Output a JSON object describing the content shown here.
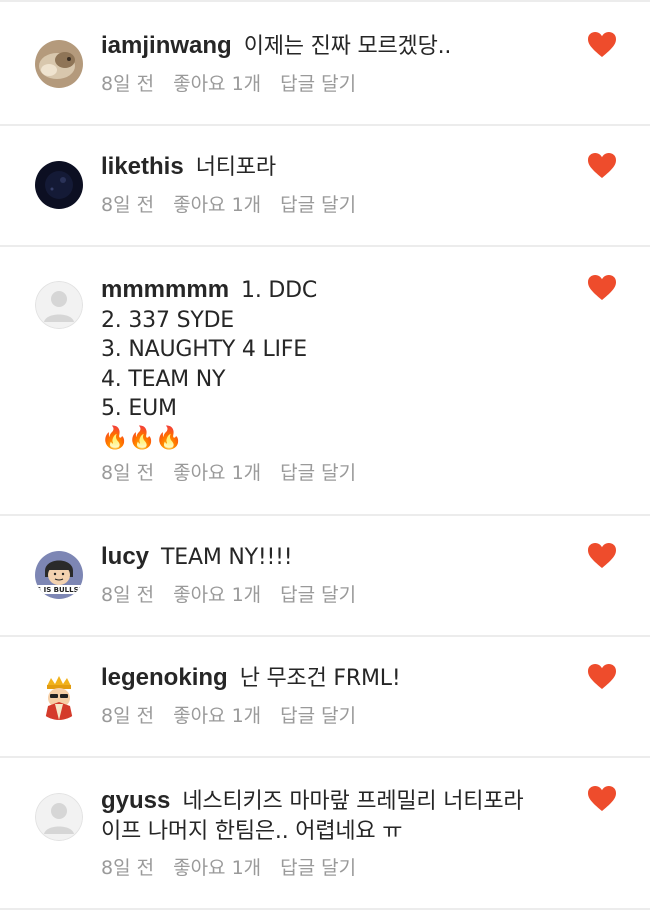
{
  "comments": [
    {
      "username": "iamjinwang",
      "text": "이제는 진짜 모르겠당..",
      "time": "8일 전",
      "likes": "좋아요 1개",
      "reply": "답글 달기",
      "avatar": "cat-photo"
    },
    {
      "username": "likethis",
      "text": "너티포라",
      "time": "8일 전",
      "likes": "좋아요 1개",
      "reply": "답글 달기",
      "avatar": "dark-photo"
    },
    {
      "username": "mmmmmm",
      "text": "1. DDC\n2. 337 SYDE\n3. NAUGHTY 4 LIFE\n4. TEAM NY\n5. EUM\n🔥🔥🔥",
      "time": "8일 전",
      "likes": "좋아요 1개",
      "reply": "답글 달기",
      "avatar": "default-person"
    },
    {
      "username": "lucy",
      "text": "TEAM NY!!!!",
      "time": "8일 전",
      "likes": "좋아요 1개",
      "reply": "답글 달기",
      "avatar": "cartoon-lucy",
      "avatar_caption": "IS IS BULLSH"
    },
    {
      "username": "legenoking",
      "text": "난 무조건 FRML!",
      "time": "8일 전",
      "likes": "좋아요 1개",
      "reply": "답글 달기",
      "avatar": "cartoon-king"
    },
    {
      "username": "gyuss",
      "text": "네스티키즈 마마랖 프레밀리 너티포라\n이프 나머지 한팀은.. 어렵네요 ㅠ",
      "time": "8일 전",
      "likes": "좋아요 1개",
      "reply": "답글 달기",
      "avatar": "default-person"
    }
  ],
  "icons": {
    "like": "heart-icon"
  },
  "colors": {
    "heart": "#ee4c2c",
    "meta": "#9a9a9a",
    "divider": "#ececec"
  }
}
